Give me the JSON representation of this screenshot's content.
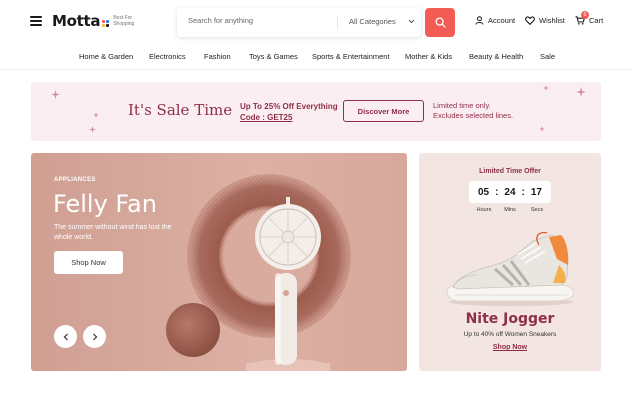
{
  "brand": {
    "name": "Motta",
    "tagline": "Best For Shopping",
    "dot_colors": [
      "#f25c54",
      "#2b7de9",
      "#f6b93b",
      "#1a1a1a"
    ]
  },
  "search": {
    "placeholder": "Search for anything",
    "category": "All Categories"
  },
  "header_links": {
    "account": "Account",
    "wishlist": "Wishlist",
    "cart": "Cart",
    "cart_count": "0"
  },
  "nav": [
    "Home & Garden",
    "Electronics",
    "Fashion",
    "Toys & Games",
    "Sports & Entertainment",
    "Mother & Kids",
    "Beauty & Health",
    "Sale"
  ],
  "promo": {
    "title": "It's Sale Time",
    "offer_line": "Up To 25% Off Everything",
    "code_line": "Code : GET25",
    "button": "Discover More",
    "note_line1": "Limited time only.",
    "note_line2": "Excludes selected lines."
  },
  "hero": {
    "eyebrow": "APPLIANCES",
    "title": "Felly Fan",
    "subtitle": "The summer without wind has lost the whole world.",
    "button": "Shop Now",
    "prev_icon": "chevron-left-icon",
    "next_icon": "chevron-right-icon"
  },
  "offer": {
    "label": "Limited Time Offer",
    "hours": "05",
    "mins": "24",
    "secs": "17",
    "hours_label": "Hours",
    "mins_label": "Mins",
    "secs_label": "Secs",
    "title": "Nite Jogger",
    "subtitle": "Up to 40% off Women Sneakers",
    "link": "Shop Now"
  },
  "colors": {
    "accent": "#f25c54",
    "brand_maroon": "#8e2f47",
    "promo_bg": "#fbeef2",
    "offer_bg": "#f2e5e2",
    "hero_bg": "#d7a89b"
  }
}
